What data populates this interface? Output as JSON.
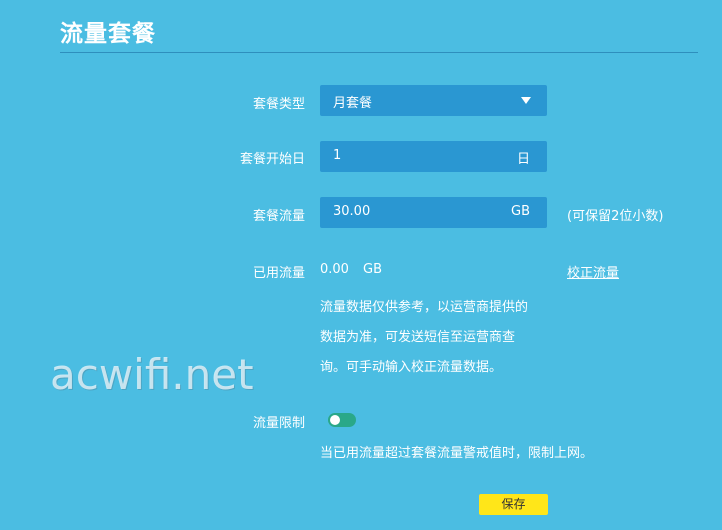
{
  "page": {
    "title": "流量套餐"
  },
  "form": {
    "plan_type": {
      "label": "套餐类型",
      "value": "月套餐"
    },
    "start_day": {
      "label": "套餐开始日",
      "value": "1",
      "unit": "日"
    },
    "plan_traffic": {
      "label": "套餐流量",
      "value": "30.00",
      "unit": "GB",
      "hint": "(可保留2位小数)"
    },
    "used_traffic": {
      "label": "已用流量",
      "value": "0.00",
      "unit": "GB",
      "correct_link": "校正流量",
      "note_lines": [
        "流量数据仅供参考，以运营商提供的",
        "数据为准，可发送短信至运营商查",
        "询。可手动输入校正流量数据。"
      ]
    },
    "traffic_limit": {
      "label": "流量限制",
      "enabled": false,
      "note": "当已用流量超过套餐流量警戒值时，限制上网。"
    }
  },
  "actions": {
    "save_label": "保存"
  },
  "watermark": {
    "text": "acwifi.net"
  },
  "colors": {
    "background": "#4bbde2",
    "field": "#2a97d2",
    "toggle": "#2aa889",
    "save_button": "#ffe619"
  }
}
